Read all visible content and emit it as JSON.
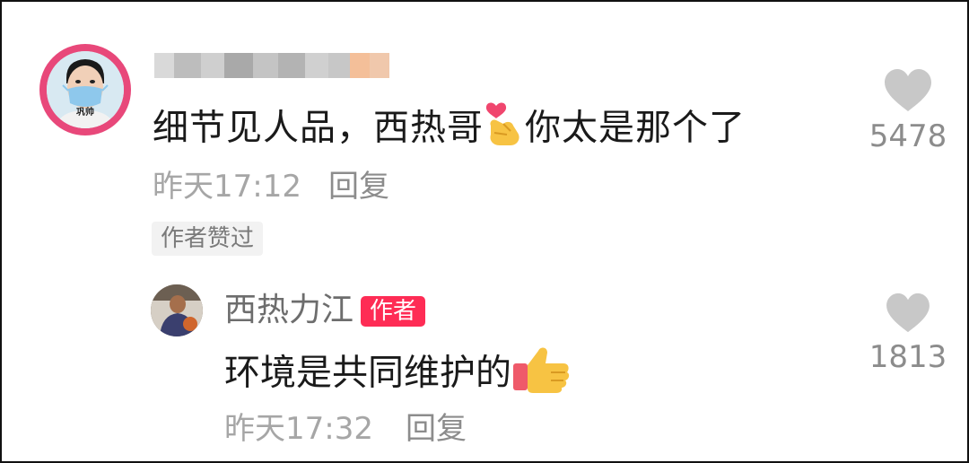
{
  "comment": {
    "username_blurred": true,
    "avatar_tag": "巩帅",
    "text_part1": "细节见人品，西热哥",
    "emoji1": "finger-heart-emoji",
    "text_part2": "你太是那个了",
    "time": "昨天17:12",
    "reply_label": "回复",
    "author_liked": "作者赞过",
    "likes": "5478"
  },
  "reply": {
    "username": "西热力江",
    "badge": "作者",
    "text": "环境是共同维护的",
    "emoji": "thumbs-up-emoji",
    "time": "昨天17:32",
    "reply_label": "回复",
    "likes": "1813"
  },
  "colors": {
    "accent": "#fe2c55",
    "avatar_ring": "#e8487a",
    "muted": "#a6a6a6",
    "heart": "#c8c8c8"
  }
}
